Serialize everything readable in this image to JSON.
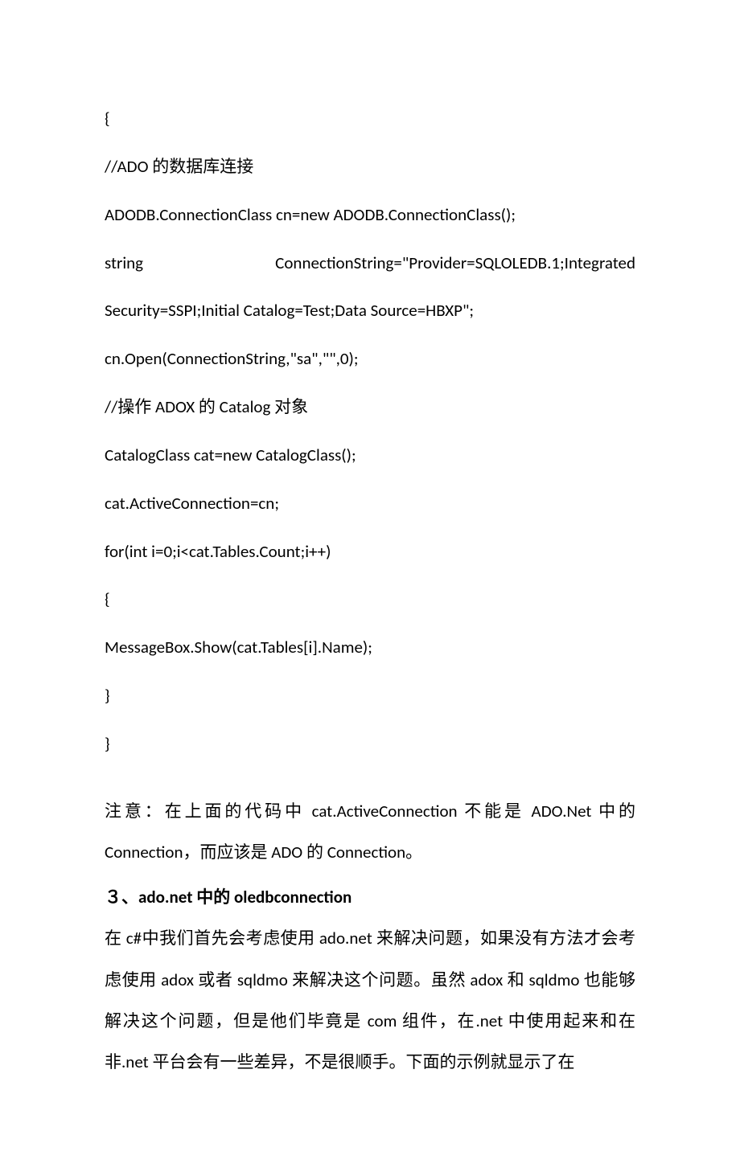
{
  "code": {
    "l1": "{",
    "l2": "//ADO 的数据库连接",
    "l3": "ADODB.ConnectionClass cn=new ADODB.ConnectionClass();",
    "l4a": "string",
    "l4b": "ConnectionString=\"Provider=SQLOLEDB.1;Integrated",
    "l5": "Security=SSPI;Initial Catalog=Test;Data Source=HBXP\";",
    "l6": "cn.Open(ConnectionString,\"sa\",\"\",0);",
    "l7": "//操作 ADOX 的 Catalog 对象",
    "l8": "CatalogClass cat=new CatalogClass();",
    "l9": "cat.ActiveConnection=cn;",
    "l10": "for(int i=0;i<cat.Tables.Count;i++)",
    "l11": "{",
    "l12": "MessageBox.Show(cat.Tables[i].Name);",
    "l13": "}",
    "l14": "}"
  },
  "note": "注意：在上面的代码中 cat.ActiveConnection 不能是 ADO.Net 中的Connection，而应该是 ADO 的 Connection。",
  "heading": "３、ado.net 中的 oledbconnection",
  "para": "在 c#中我们首先会考虑使用 ado.net 来解决问题，如果没有方法才会考虑使用 adox 或者 sqldmo 来解决这个问题。虽然 adox 和 sqldmo 也能够解决这个问题，但是他们毕竟是 com 组件，在.net 中使用起来和在非.net 平台会有一些差异，不是很顺手。下面的示例就显示了在"
}
